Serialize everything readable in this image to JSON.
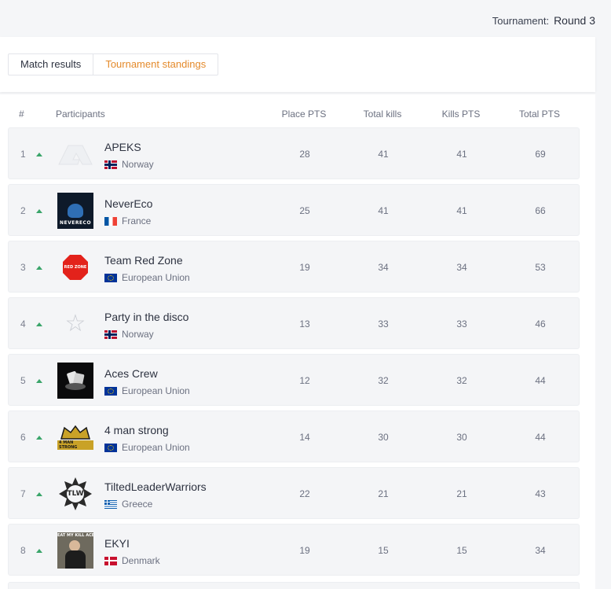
{
  "header": {
    "tournament_label": "Tournament:",
    "tournament_value": "Round 3"
  },
  "tabs": [
    {
      "label": "Match results",
      "active": false
    },
    {
      "label": "Tournament standings",
      "active": true
    }
  ],
  "columns": {
    "rank": "#",
    "participants": "Participants",
    "place_pts": "Place PTS",
    "total_kills": "Total kills",
    "kills_pts": "Kills PTS",
    "total_pts": "Total PTS"
  },
  "colors": {
    "accent": "#e48a2b",
    "trend_up": "#3aa56a"
  },
  "rows": [
    {
      "rank": "1",
      "name": "APEKS",
      "country": "Norway",
      "flag": "norway",
      "logo": "apeks-logo",
      "place_pts": "28",
      "total_kills": "41",
      "kills_pts": "41",
      "total_pts": "69"
    },
    {
      "rank": "2",
      "name": "NeverEco",
      "country": "France",
      "flag": "france",
      "logo": "nevereco-logo",
      "logo_text": "NEVERECO",
      "place_pts": "25",
      "total_kills": "41",
      "kills_pts": "41",
      "total_pts": "66"
    },
    {
      "rank": "3",
      "name": "Team Red Zone",
      "country": "European Union",
      "flag": "eu",
      "logo": "red-zone-logo",
      "logo_text": "RED ZONE",
      "place_pts": "19",
      "total_kills": "34",
      "kills_pts": "34",
      "total_pts": "53"
    },
    {
      "rank": "4",
      "name": "Party in the disco",
      "country": "Norway",
      "flag": "norway",
      "logo": "star-placeholder-logo",
      "place_pts": "13",
      "total_kills": "33",
      "kills_pts": "33",
      "total_pts": "46"
    },
    {
      "rank": "5",
      "name": "Aces Crew",
      "country": "European Union",
      "flag": "eu",
      "logo": "aces-crew-logo",
      "place_pts": "12",
      "total_kills": "32",
      "kills_pts": "32",
      "total_pts": "44"
    },
    {
      "rank": "6",
      "name": "4 man strong",
      "country": "European Union",
      "flag": "eu",
      "logo": "4-man-strong-logo",
      "logo_text": "4 MAN STRONG",
      "place_pts": "14",
      "total_kills": "30",
      "kills_pts": "30",
      "total_pts": "44"
    },
    {
      "rank": "7",
      "name": "TiltedLeaderWarriors",
      "country": "Greece",
      "flag": "greece",
      "logo": "tlw-logo",
      "logo_text": "TLW",
      "place_pts": "22",
      "total_kills": "21",
      "kills_pts": "21",
      "total_pts": "43"
    },
    {
      "rank": "8",
      "name": "EKYI",
      "country": "Denmark",
      "flag": "denmark",
      "logo": "ekyi-logo",
      "logo_text": "EAT MY KILL ACE",
      "place_pts": "19",
      "total_kills": "15",
      "kills_pts": "15",
      "total_pts": "34"
    }
  ]
}
